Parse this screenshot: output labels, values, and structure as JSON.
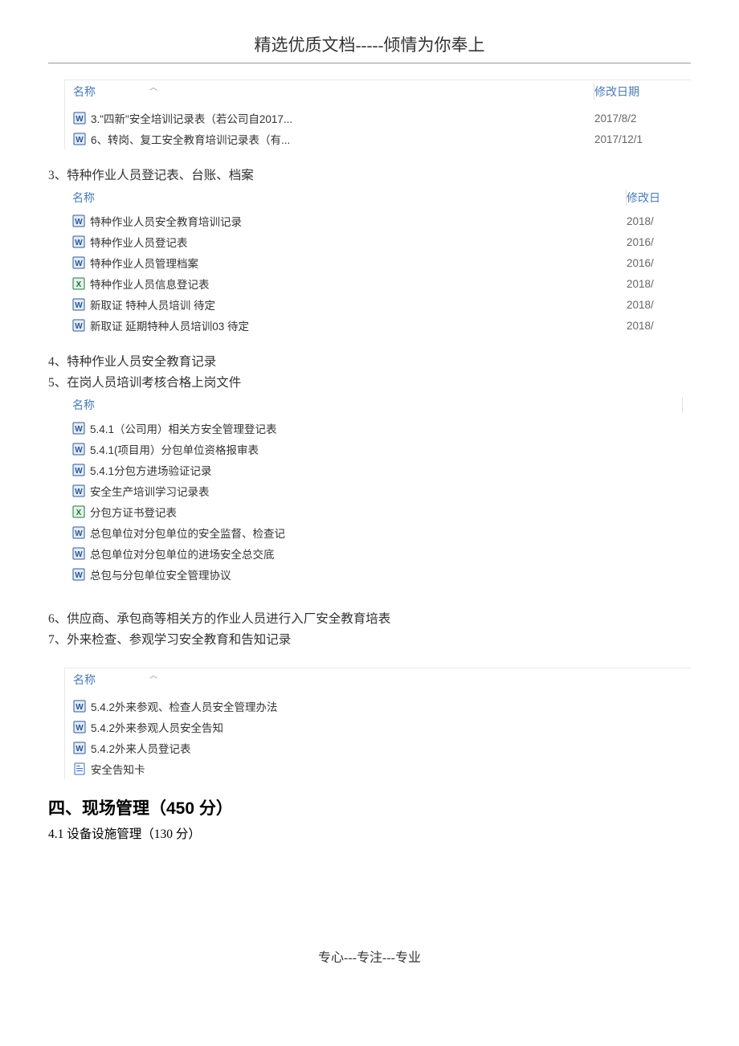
{
  "header": {
    "title": "精选优质文档-----倾情为你奉上"
  },
  "list1": {
    "header_name": "名称",
    "header_date": "修改日期",
    "rows": [
      {
        "icon": "word",
        "name": "3.\"四新\"安全培训记录表（若公司自2017...",
        "date": "2017/8/2"
      },
      {
        "icon": "word",
        "name": "6、转岗、复工安全教育培训记录表（有...",
        "date": "2017/12/1"
      }
    ]
  },
  "item3": "3、特种作业人员登记表、台账、档案",
  "list2": {
    "header_name": "名称",
    "header_date": "修改日",
    "rows": [
      {
        "icon": "word",
        "name": "特种作业人员安全教育培训记录",
        "date": "2018/"
      },
      {
        "icon": "word",
        "name": "特种作业人员登记表",
        "date": "2016/"
      },
      {
        "icon": "word",
        "name": "特种作业人员管理档案",
        "date": "2016/"
      },
      {
        "icon": "excel",
        "name": "特种作业人员信息登记表",
        "date": "2018/"
      },
      {
        "icon": "word",
        "name": "新取证  特种人员培训          待定",
        "date": "2018/"
      },
      {
        "icon": "word",
        "name": "新取证  延期特种人员培训03    待定",
        "date": "2018/"
      }
    ]
  },
  "item4": "4、特种作业人员安全教育记录",
  "item5": "5、在岗人员培训考核合格上岗文件",
  "list3": {
    "header_name": "名称",
    "rows": [
      {
        "icon": "word",
        "name": "5.4.1（公司用）相关方安全管理登记表"
      },
      {
        "icon": "word",
        "name": "5.4.1(项目用）分包单位资格报审表"
      },
      {
        "icon": "word",
        "name": "5.4.1分包方进场验证记录"
      },
      {
        "icon": "word",
        "name": "安全生产培训学习记录表"
      },
      {
        "icon": "excel",
        "name": "分包方证书登记表"
      },
      {
        "icon": "word",
        "name": "总包单位对分包单位的安全监督、检查记"
      },
      {
        "icon": "word",
        "name": "总包单位对分包单位的进场安全总交底"
      },
      {
        "icon": "word",
        "name": "总包与分包单位安全管理协议"
      }
    ]
  },
  "item6": "6、供应商、承包商等相关方的作业人员进行入厂安全教育培表",
  "item7": "7、外来检查、参观学习安全教育和告知记录",
  "list4": {
    "header_name": "名称",
    "rows": [
      {
        "icon": "word",
        "name": "5.4.2外来参观、检查人员安全管理办法"
      },
      {
        "icon": "word",
        "name": "5.4.2外来参观人员安全告知"
      },
      {
        "icon": "word",
        "name": "5.4.2外来人员登记表"
      },
      {
        "icon": "doc",
        "name": "安全告知卡"
      }
    ]
  },
  "section4": {
    "heading": "四、现场管理（450 分）",
    "sub": "4.1 设备设施管理（130 分）"
  },
  "footer": "专心---专注---专业"
}
